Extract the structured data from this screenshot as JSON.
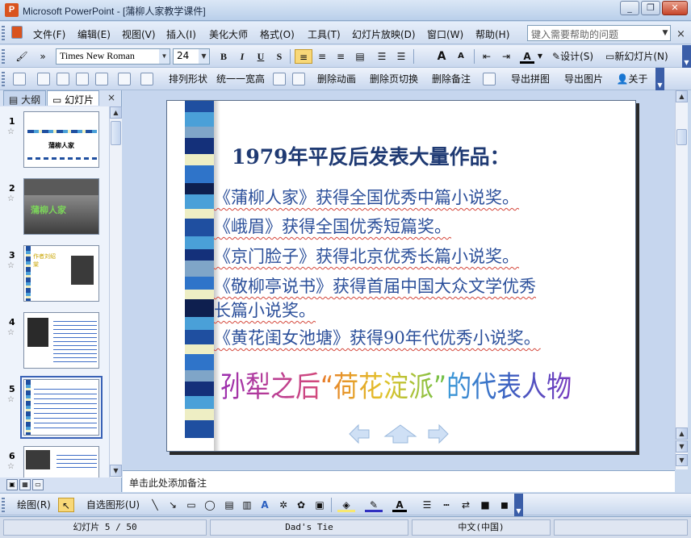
{
  "window": {
    "title": "Microsoft PowerPoint - [蒲柳人家教学课件]",
    "controls": {
      "minimize": "_",
      "restore": "❐",
      "close": "✕"
    }
  },
  "menubar": {
    "items": [
      "文件(F)",
      "编辑(E)",
      "视图(V)",
      "插入(I)",
      "美化大师",
      "格式(O)",
      "工具(T)",
      "幻灯片放映(D)",
      "窗口(W)",
      "帮助(H)"
    ],
    "help_placeholder": "键入需要帮助的问题",
    "close": "×"
  },
  "format_toolbar": {
    "font": "Times New Roman",
    "size": "24",
    "bold": "B",
    "italic": "I",
    "underline": "U",
    "shadow": "S",
    "increase_font": "A",
    "decrease_font": "A",
    "font_color": "A",
    "design": "设计(S)",
    "new_slide": "新幻灯片(N)"
  },
  "tools_toolbar": {
    "arrange": "排列形状",
    "unify": "统一一宽高",
    "delete_anim": "删除动画",
    "delete_trans": "删除页切换",
    "delete_notes": "删除备注",
    "export_collage": "导出拼图",
    "export_image": "导出图片",
    "about": "关于"
  },
  "left_pane": {
    "tabs": [
      "大纲",
      "幻灯片"
    ],
    "active_tab": 1,
    "close": "×",
    "slides": [
      {
        "num": "1",
        "label": "蒲柳人家"
      },
      {
        "num": "2",
        "label": "蒲柳人家"
      },
      {
        "num": "3",
        "label": "作者刘绍棠"
      },
      {
        "num": "4",
        "label": ""
      },
      {
        "num": "5",
        "label": ""
      },
      {
        "num": "6",
        "label": ""
      }
    ],
    "selected": 5
  },
  "slide": {
    "heading": "1979年平反后发表大量作品：",
    "lines": [
      "《蒲柳人家》获得全国优秀中篇小说奖。",
      "《峨眉》获得全国优秀短篇奖。",
      "《京门脸子》获得北京优秀长篇小说奖。",
      "《敬柳亭说书》获得首届中国大众文学优秀",
      "长篇小说奖。",
      "《黄花闺女池塘》获得90年代优秀小说奖。"
    ],
    "wordart": [
      "孙犁之后",
      "“荷花淀派”",
      "的代表人物"
    ]
  },
  "notes": {
    "placeholder": "单击此处添加备注"
  },
  "draw_toolbar": {
    "draw": "绘图(R)",
    "autoshapes": "自选图形(U)"
  },
  "statusbar": {
    "slide_pos": "幻灯片 5 / 50",
    "design": "Dad's Tie",
    "language": "中文(中国)"
  }
}
